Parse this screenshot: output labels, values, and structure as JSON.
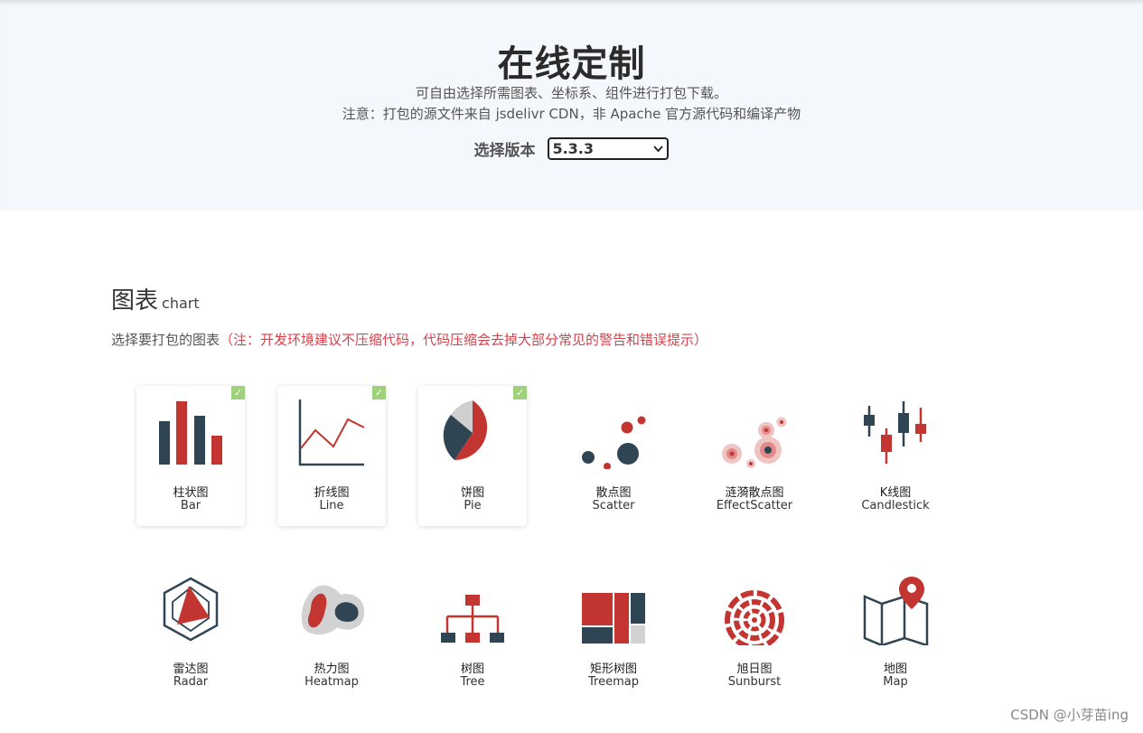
{
  "hero": {
    "title": "在线定制",
    "subtitle_line1": "可自由选择所需图表、坐标系、组件进行打包下载。",
    "subtitle_line2": "注意：打包的源文件来自 jsdelivr CDN，非 Apache 官方源代码和编译产物",
    "version_label": "选择版本",
    "version_value": "5.3.3"
  },
  "section": {
    "title": "图表",
    "title_en": "chart",
    "desc": "选择要打包的图表",
    "note": "（注：开发环境建议不压缩代码，代码压缩会去掉大部分常见的警告和错误提示）"
  },
  "charts": [
    {
      "zh": "柱状图",
      "en": "Bar",
      "selected": true,
      "icon": "bar-chart-icon"
    },
    {
      "zh": "折线图",
      "en": "Line",
      "selected": true,
      "icon": "line-chart-icon"
    },
    {
      "zh": "饼图",
      "en": "Pie",
      "selected": true,
      "icon": "pie-chart-icon"
    },
    {
      "zh": "散点图",
      "en": "Scatter",
      "selected": false,
      "icon": "scatter-chart-icon"
    },
    {
      "zh": "涟漪散点图",
      "en": "EffectScatter",
      "selected": false,
      "icon": "effect-scatter-icon"
    },
    {
      "zh": "K线图",
      "en": "Candlestick",
      "selected": false,
      "icon": "candlestick-icon"
    },
    {
      "zh": "雷达图",
      "en": "Radar",
      "selected": false,
      "icon": "radar-chart-icon"
    },
    {
      "zh": "热力图",
      "en": "Heatmap",
      "selected": false,
      "icon": "heatmap-icon"
    },
    {
      "zh": "树图",
      "en": "Tree",
      "selected": false,
      "icon": "tree-chart-icon"
    },
    {
      "zh": "矩形树图",
      "en": "Treemap",
      "selected": false,
      "icon": "treemap-icon"
    },
    {
      "zh": "旭日图",
      "en": "Sunburst",
      "selected": false,
      "icon": "sunburst-icon"
    },
    {
      "zh": "地图",
      "en": "Map",
      "selected": false,
      "icon": "map-icon"
    }
  ],
  "colors": {
    "red": "#c23531",
    "navy": "#2f4554",
    "check": "#9fd07a"
  },
  "watermark": "CSDN @小芽苗ing"
}
